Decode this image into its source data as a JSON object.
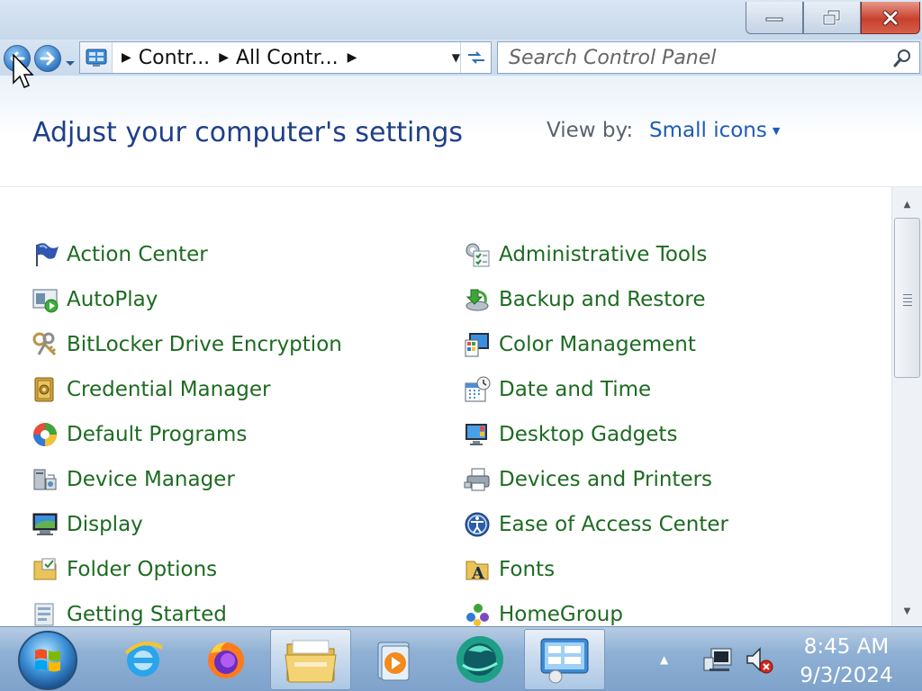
{
  "window": {
    "minimize_label": "Minimize",
    "maximize_label": "Restore",
    "close_label": "Close"
  },
  "address": {
    "crumbs": [
      "Contr...",
      "All Contr..."
    ]
  },
  "search": {
    "placeholder": "Search Control Panel"
  },
  "header": {
    "title": "Adjust your computer's settings",
    "view_by_label": "View by:",
    "view_by_value": "Small icons"
  },
  "items_left": [
    {
      "label": "Action Center",
      "icon": "flag-icon"
    },
    {
      "label": "AutoPlay",
      "icon": "autoplay-icon"
    },
    {
      "label": "BitLocker Drive Encryption",
      "icon": "keys-icon"
    },
    {
      "label": "Credential Manager",
      "icon": "vault-icon"
    },
    {
      "label": "Default Programs",
      "icon": "default-programs-icon"
    },
    {
      "label": "Device Manager",
      "icon": "device-manager-icon"
    },
    {
      "label": "Display",
      "icon": "display-icon"
    },
    {
      "label": "Folder Options",
      "icon": "folder-options-icon"
    },
    {
      "label": "Getting Started",
      "icon": "getting-started-icon"
    }
  ],
  "items_right": [
    {
      "label": "Administrative Tools",
      "icon": "admin-tools-icon"
    },
    {
      "label": "Backup and Restore",
      "icon": "backup-icon"
    },
    {
      "label": "Color Management",
      "icon": "color-management-icon"
    },
    {
      "label": "Date and Time",
      "icon": "calendar-clock-icon"
    },
    {
      "label": "Desktop Gadgets",
      "icon": "gadgets-icon"
    },
    {
      "label": "Devices and Printers",
      "icon": "printer-icon"
    },
    {
      "label": "Ease of Access Center",
      "icon": "ease-of-access-icon"
    },
    {
      "label": "Fonts",
      "icon": "fonts-icon"
    },
    {
      "label": "HomeGroup",
      "icon": "homegroup-icon"
    }
  ],
  "taskbar": {
    "apps": [
      "internet-explorer-icon",
      "firefox-icon",
      "file-explorer-icon",
      "media-player-icon",
      "app-icon",
      "control-panel-icon"
    ],
    "time": "8:45 AM",
    "date": "9/3/2024"
  },
  "colors": {
    "link_green": "#1d6b21",
    "title_blue": "#1e3f8a",
    "accent_blue": "#1e5bb8"
  }
}
